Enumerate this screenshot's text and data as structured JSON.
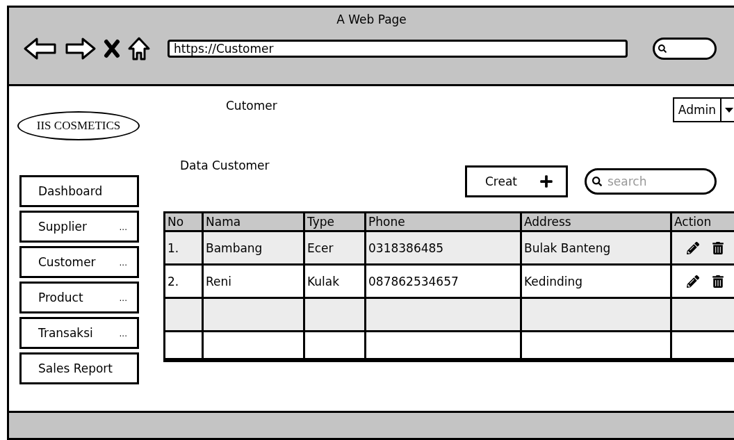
{
  "window": {
    "title": "A Web Page"
  },
  "address_bar": {
    "value": "https://Customer"
  },
  "logo": "IIS COSMETICS",
  "page_title": "Cutomer",
  "user_menu": {
    "label": "Admin"
  },
  "sidebar": {
    "items": [
      {
        "label": "Dashboard"
      },
      {
        "label": "Supplier",
        "more": "..."
      },
      {
        "label": "Customer",
        "more": "..."
      },
      {
        "label": "Product",
        "more": "..."
      },
      {
        "label": "Transaksi",
        "more": "..."
      },
      {
        "label": "Sales Report"
      }
    ]
  },
  "section_title": "Data Customer",
  "create_button": {
    "label": "Creat"
  },
  "search": {
    "placeholder": "search"
  },
  "table": {
    "columns": [
      "No",
      "Nama",
      "Type",
      "Phone",
      "Address",
      "Action"
    ],
    "rows": [
      {
        "no": "1.",
        "nama": "Bambang",
        "type": "Ecer",
        "phone": "0318386485",
        "address": "Bulak Banteng"
      },
      {
        "no": "2.",
        "nama": "Reni",
        "type": "Kulak",
        "phone": "087862534657",
        "address": "Kedinding"
      }
    ]
  }
}
